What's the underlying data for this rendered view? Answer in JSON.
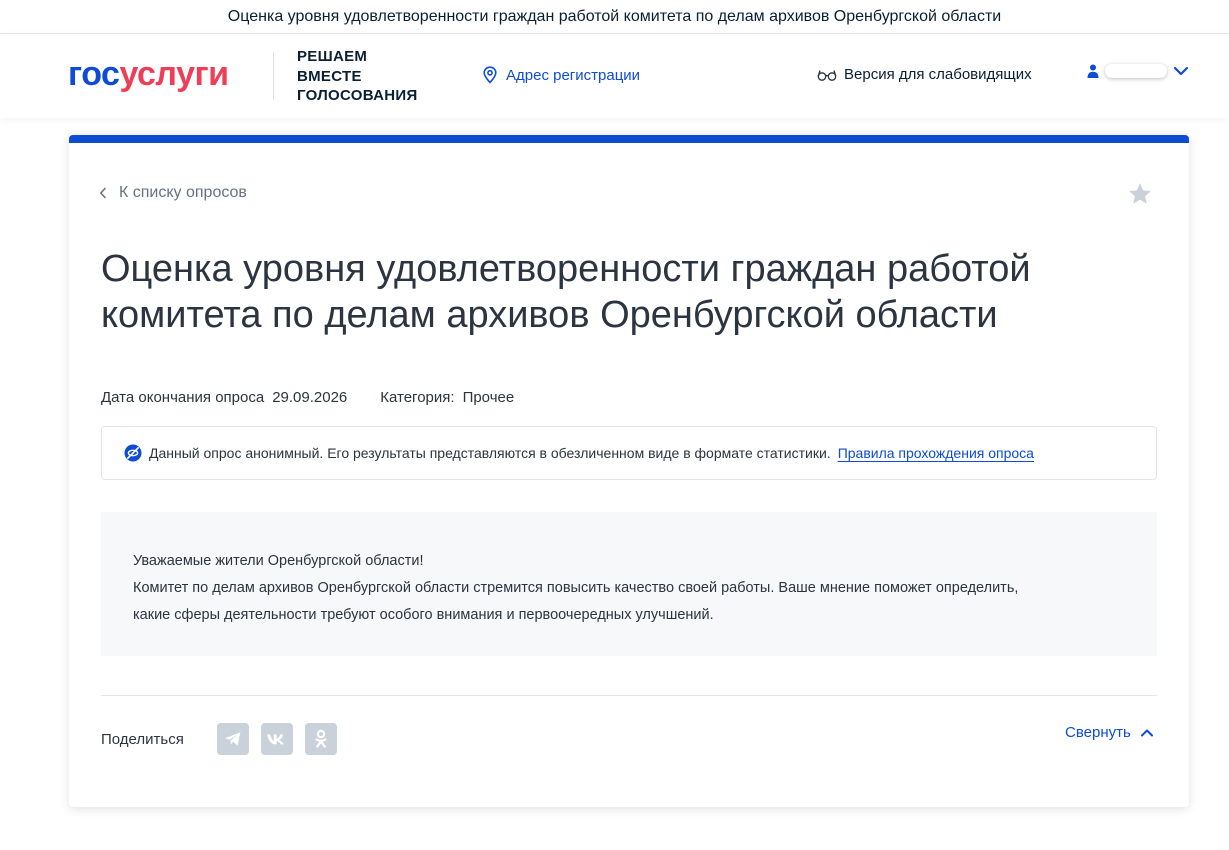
{
  "top_bar": {
    "title": "Оценка уровня удовлетворенности граждан работой комитета по делам архивов Оренбургской области"
  },
  "header": {
    "logo": {
      "part1": "гос",
      "part2": "услуги"
    },
    "tagline": [
      "РЕШАЕМ",
      "ВМЕСТЕ",
      "ГОЛОСОВАНИЯ"
    ],
    "address_link": "Адрес регистрации",
    "low_vision_link": "Версия для слабовидящих"
  },
  "survey": {
    "back_link": "К списку опросов",
    "title": "Оценка уровня удовлетворенности граждан работой комитета по делам архивов Оренбургской области",
    "end_date_label": "Дата окончания опроса",
    "end_date": "29.09.2026",
    "category_label": "Категория:",
    "category": "Прочее",
    "notice_text": "Данный опрос анонимный. Его результаты представляются в обезличенном виде в формате статистики.",
    "notice_link": "Правила прохождения опроса",
    "description": [
      "Уважаемые жители Оренбургской области!",
      "Комитет по делам архивов Оренбургской области стремится повысить качество своей работы. Ваше мнение поможет определить,",
      "какие сферы деятельности требуют особого внимания и первоочередных улучшений."
    ],
    "share_label": "Поделиться",
    "share_networks": [
      "telegram-icon",
      "vk-icon",
      "odnoklassniki-icon"
    ],
    "collapse_label": "Свернуть"
  },
  "colors": {
    "brand_blue": "#0d4cd3",
    "brand_red": "#ee3f58",
    "text_dark": "#2b3440",
    "muted": "#66727f",
    "share_gray": "#c9d1db"
  }
}
